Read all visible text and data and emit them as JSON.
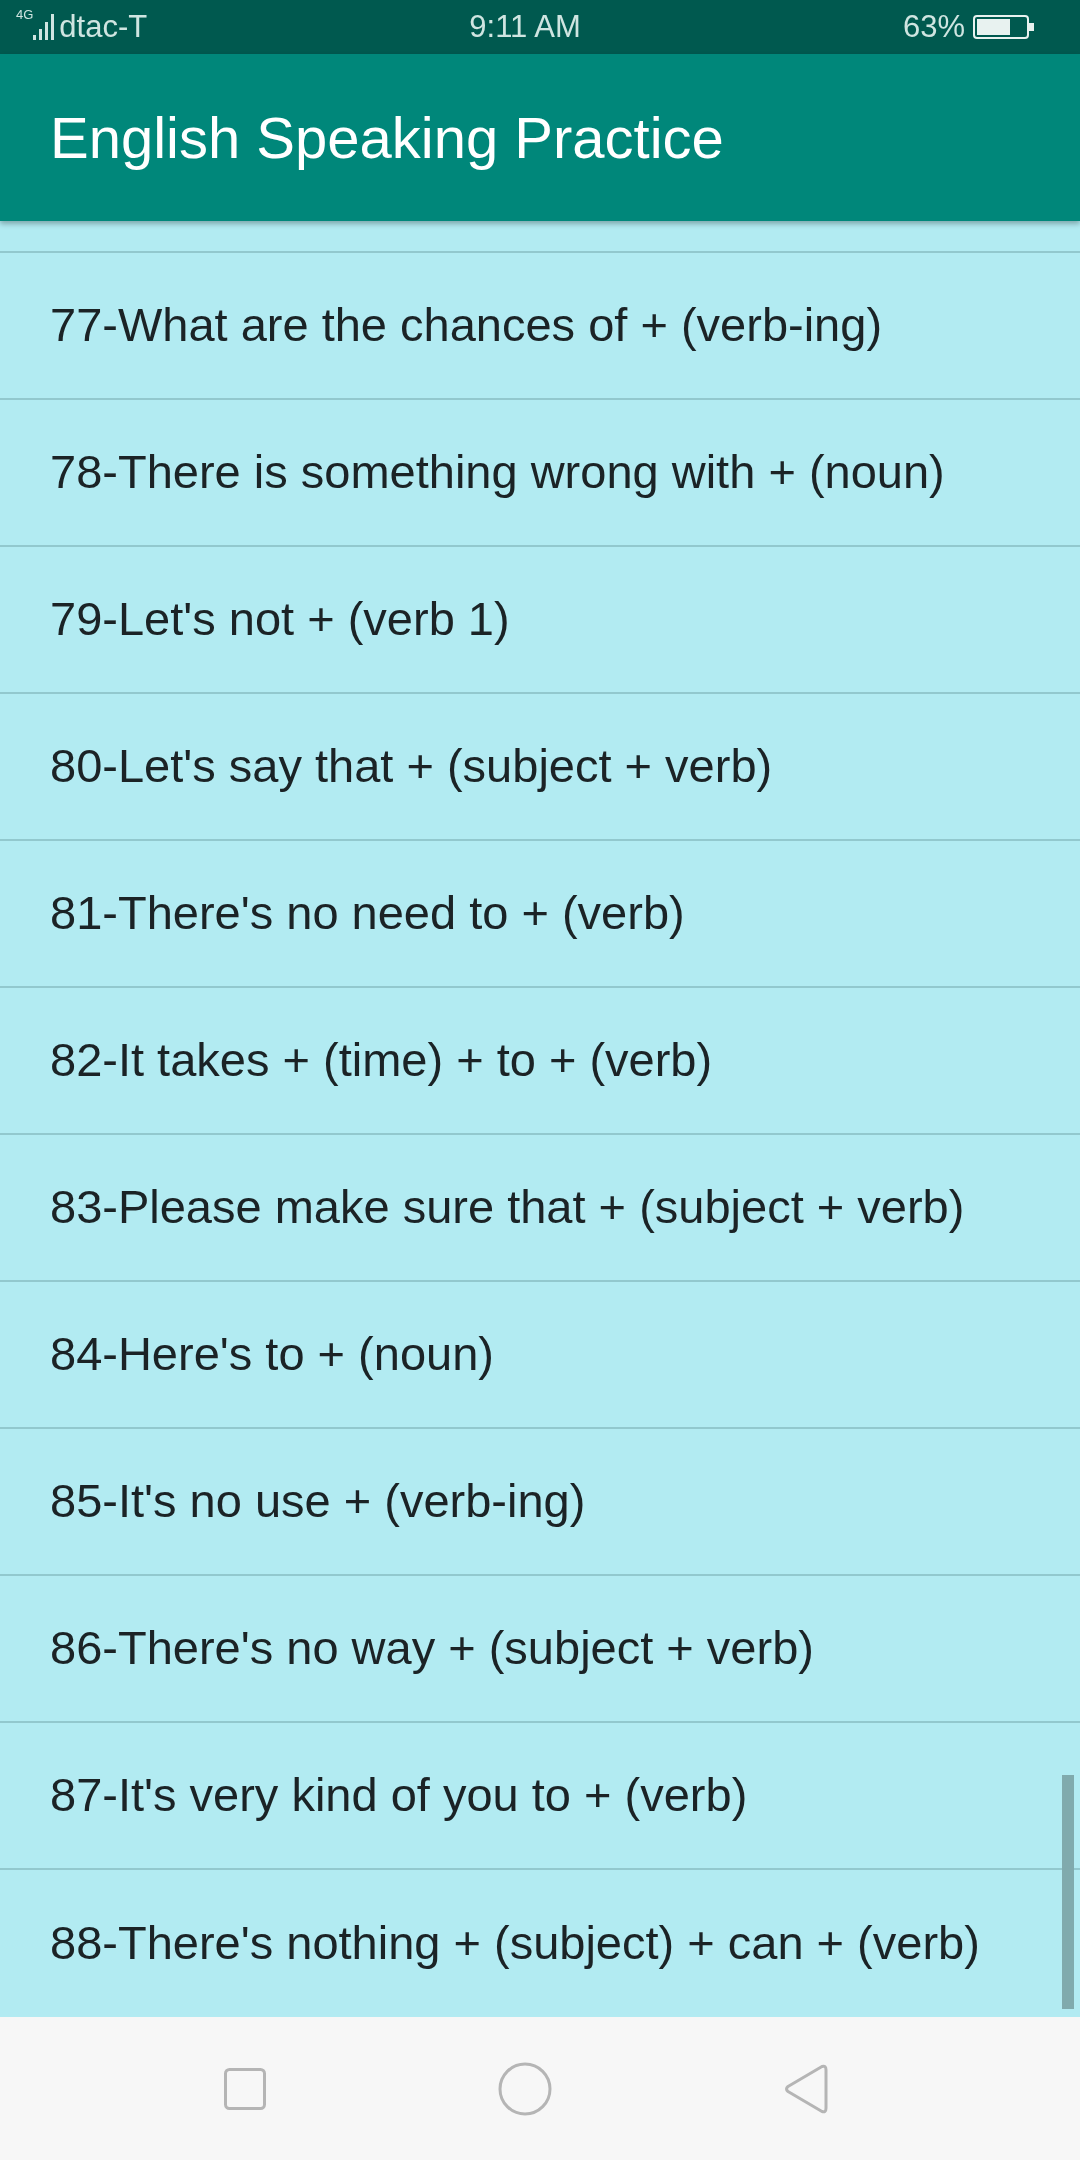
{
  "status_bar": {
    "network": "4G",
    "carrier": "dtac-T",
    "time": "9:11 AM",
    "battery": "63%"
  },
  "app_bar": {
    "title": "English Speaking Practice"
  },
  "list": {
    "items": [
      {
        "text": "77-What are the chances of + (verb-ing)"
      },
      {
        "text": "78-There is something wrong with + (noun)"
      },
      {
        "text": "79-Let's not + (verb 1)"
      },
      {
        "text": "80-Let's say that + (subject + verb)"
      },
      {
        "text": "81-There's no need to + (verb)"
      },
      {
        "text": "82-It takes + (time) + to + (verb)"
      },
      {
        "text": "83-Please make sure that + (subject + verb)"
      },
      {
        "text": "84-Here's to + (noun)"
      },
      {
        "text": "85-It's no use + (verb-ing)"
      },
      {
        "text": "86-There's no way + (subject + verb)"
      },
      {
        "text": "87-It's very kind of you to + (verb)"
      },
      {
        "text": "88-There's nothing + (subject) + can + (verb)"
      }
    ]
  }
}
